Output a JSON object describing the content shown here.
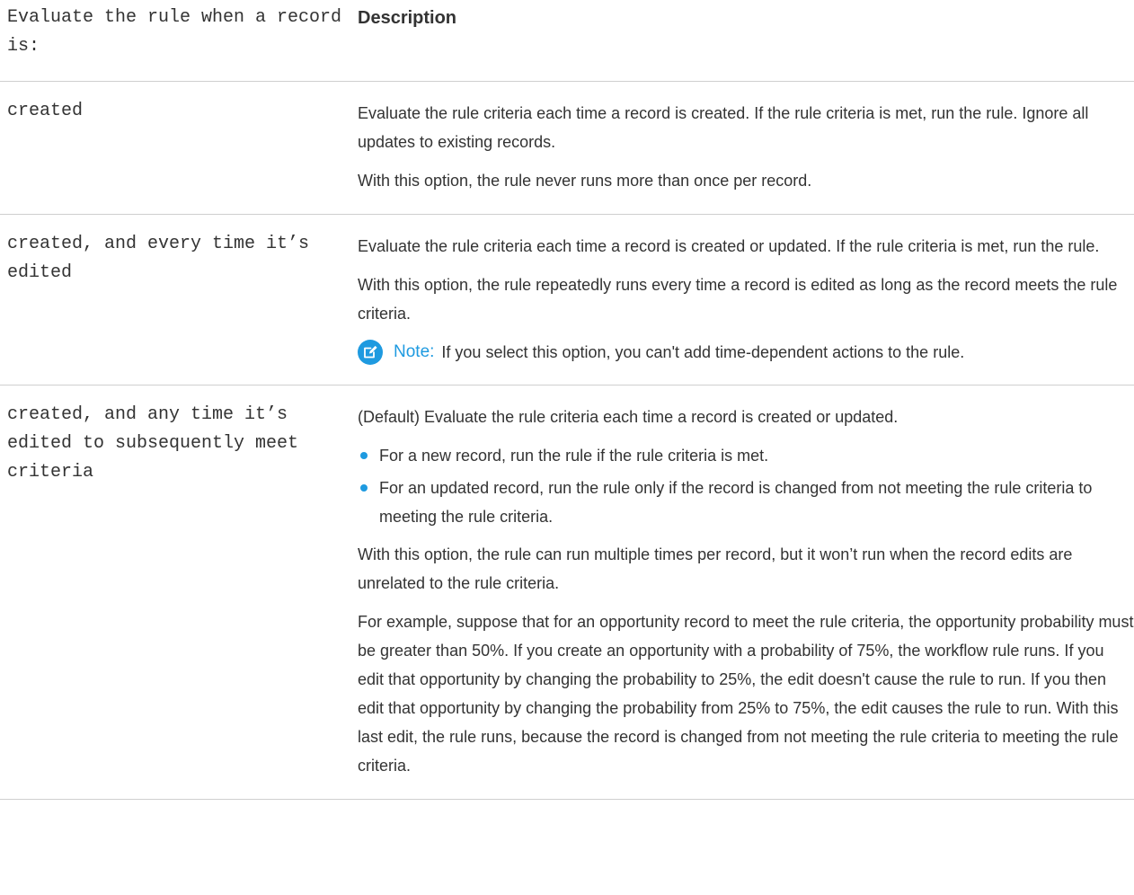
{
  "table": {
    "header_option": "Evaluate the rule when a record is:",
    "header_description": "Description",
    "rows": [
      {
        "option": "created",
        "paragraphs": [
          "Evaluate the rule criteria each time a record is created. If the rule criteria is met, run the rule. Ignore all updates to existing records.",
          "With this option, the rule never runs more than once per record."
        ]
      },
      {
        "option": "created, and every time it’s edited",
        "paragraphs": [
          "Evaluate the rule criteria each time a record is created or updated. If the rule criteria is met, run the rule.",
          "With this option, the rule repeatedly runs every time a record is edited as long as the record meets the rule criteria."
        ],
        "note": {
          "label": "Note:",
          "text": "If you select this option, you can't add time-dependent actions to the rule.",
          "icon": "edit-note-icon",
          "color": "#1e9ae0"
        }
      },
      {
        "option": "created, and any time it’s edited to subsequently meet criteria",
        "intro": "(Default) Evaluate the rule criteria each time a record is created or updated.",
        "bullets": [
          "For a new record, run the rule if the rule criteria is met.",
          "For an updated record, run the rule only if the record is changed from not meeting the rule criteria to meeting the rule criteria."
        ],
        "paragraphs": [
          "With this option, the rule can run multiple times per record, but it won’t run when the record edits are unrelated to the rule criteria.",
          "For example, suppose that for an opportunity record to meet the rule criteria, the opportunity probability must be greater than 50%. If you create an opportunity with a probability of 75%, the workflow rule runs. If you edit that opportunity by changing the probability to 25%, the edit doesn't cause the rule to run. If you then edit that opportunity by changing the probability from 25% to 75%, the edit causes the rule to run. With this last edit, the rule runs, because the record is changed from not meeting the rule criteria to meeting the rule criteria."
        ]
      }
    ]
  }
}
